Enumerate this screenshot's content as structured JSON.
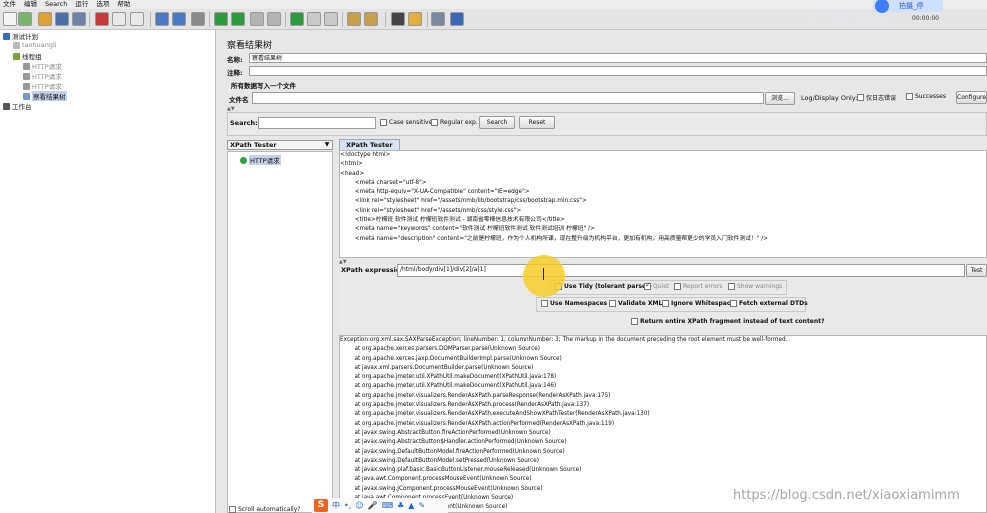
{
  "menu": [
    "文件",
    "编辑",
    "Search",
    "运行",
    "选项",
    "帮助"
  ],
  "toolbar": {
    "buttons": [
      "new-icon",
      "template-icon",
      "open-icon",
      "save-icon",
      "save-as-icon",
      "cut-icon",
      "copy-icon",
      "paste-icon",
      "expand-icon",
      "collapse-icon",
      "toggle-icon",
      "start-icon",
      "start-no-pause-icon",
      "stop-icon",
      "shutdown-icon",
      "remote-start-icon",
      "remote-stop-icon",
      "remote-shutdown-icon",
      "clear-icon",
      "clear-all-icon",
      "search-icon",
      "reset-search-icon",
      "function-helper-icon",
      "help-icon"
    ],
    "timer": "00:00:00",
    "overlay_chip": "拍摄_停",
    "overlay_text": "行题讲解"
  },
  "tree": {
    "items": [
      {
        "label": "测试计划",
        "indent": 0
      },
      {
        "label": "taohuangli",
        "indent": 1
      },
      {
        "label": "线程组",
        "indent": 1
      },
      {
        "label": "HTTP请求",
        "indent": 2
      },
      {
        "label": "HTTP请求",
        "indent": 2
      },
      {
        "label": "HTTP请求",
        "indent": 2
      },
      {
        "label": "察看结果树",
        "indent": 2
      },
      {
        "label": "工作台",
        "indent": 0
      }
    ]
  },
  "listener": {
    "title": "察看结果树",
    "name_label": "名称:",
    "name_value": "察看结果树",
    "comment_label": "注释:",
    "write_all_label": "所有数据写入一个文件",
    "filename_label": "文件名",
    "browse_label": "浏览...",
    "log_display_label": "Log/Display Only:",
    "errors_label": "仅日志错误",
    "successes_label": "Successes",
    "configure_label": "Configure"
  },
  "search": {
    "label": "Search:",
    "case_sensitive": "Case sensitive",
    "regular_exp": "Regular exp.",
    "search_button": "Search",
    "reset_button": "Reset"
  },
  "results": {
    "renderer": "XPath Tester",
    "samples": [
      "HTTP请求"
    ],
    "tab": "XPath Tester"
  },
  "source_lines": [
    "<!doctype html>",
    "<html>",
    "<head>",
    "",
    "        <meta charset=\"utf-8\">",
    "        <meta http-equiv=\"X-UA-Compatible\" content=\"IE=edge\">",
    "        <link rel=\"stylesheet\" href=\"/assets/nmb/lib/bootstrap/css/bootstrap.min.css\">",
    "        <link rel=\"stylesheet\" href=\"/assets/nmb/css/style.css\">",
    "        <title>柠檬班 软件测试 柠檬班软件测试 - 湖南省零檬信息技术有限公司</title>",
    "        <meta name=\"keywords\" content=\"软件测试 柠檬班软件测试 软件测试培训 柠檬班\" />",
    "        <meta name=\"description\" content=\"之前是柠檬班，作为个人机构所课，现在整升级为机构平台，更加有机构，用高质量帮更少的学员入门软件测试！\" />"
  ],
  "xpath": {
    "label": "XPath expression",
    "value": "/html/body/div[1]/div[2]/a[1]",
    "test_button": "Test",
    "use_tidy": "Use Tidy (tolerant parser)",
    "quiet": "Quiet",
    "report_errors": "Report errors",
    "show_warnings": "Show warnings",
    "use_namespaces": "Use Namespaces",
    "validate_xml": "Validate XML",
    "ignore_whitespace": "Ignore Whitespace",
    "fetch_dtds": "Fetch external DTDs",
    "return_fragment": "Return entire XPath fragment instead of text content?"
  },
  "output_lines": [
    "Exception:org.xml.sax.SAXParseException; lineNumber: 1; columnNumber: 3; The markup in the document preceding the root element must be well-formed.",
    "        at org.apache.xerces.parsers.DOMParser.parse(Unknown Source)",
    "        at org.apache.xerces.jaxp.DocumentBuilderImpl.parse(Unknown Source)",
    "        at javax.xml.parsers.DocumentBuilder.parse(Unknown Source)",
    "        at org.apache.jmeter.util.XPathUtil.makeDocument(XPathUtil.java:178)",
    "        at org.apache.jmeter.util.XPathUtil.makeDocument(XPathUtil.java:146)",
    "        at org.apache.jmeter.visualizers.RenderAsXPath.parseResponse(RenderAsXPath.java:175)",
    "        at org.apache.jmeter.visualizers.RenderAsXPath.process(RenderAsXPath.java:137)",
    "        at org.apache.jmeter.visualizers.RenderAsXPath.executeAndShowXPathTester(RenderAsXPath.java:130)",
    "        at org.apache.jmeter.visualizers.RenderAsXPath.actionPerformed(RenderAsXPath.java:119)",
    "        at javax.swing.AbstractButton.fireActionPerformed(Unknown Source)",
    "        at javax.swing.AbstractButton$Handler.actionPerformed(Unknown Source)",
    "        at javax.swing.DefaultButtonModel.fireActionPerformed(Unknown Source)",
    "        at javax.swing.DefaultButtonModel.setPressed(Unknown Source)",
    "        at javax.swing.plaf.basic.BasicButtonListener.mouseReleased(Unknown Source)",
    "        at java.awt.Component.processMouseEvent(Unknown Source)",
    "        at javax.swing.JComponent.processMouseEvent(Unknown Source)",
    "        at java.awt.Component.processEvent(Unknown Source)",
    "        at java.awt.Container.processEvent(Unknown Source)"
  ],
  "footer": {
    "scroll_auto": "Scroll automatically?",
    "ime_label": "中",
    "watermark": "https://blog.csdn.net/xiaoxiamimm"
  }
}
